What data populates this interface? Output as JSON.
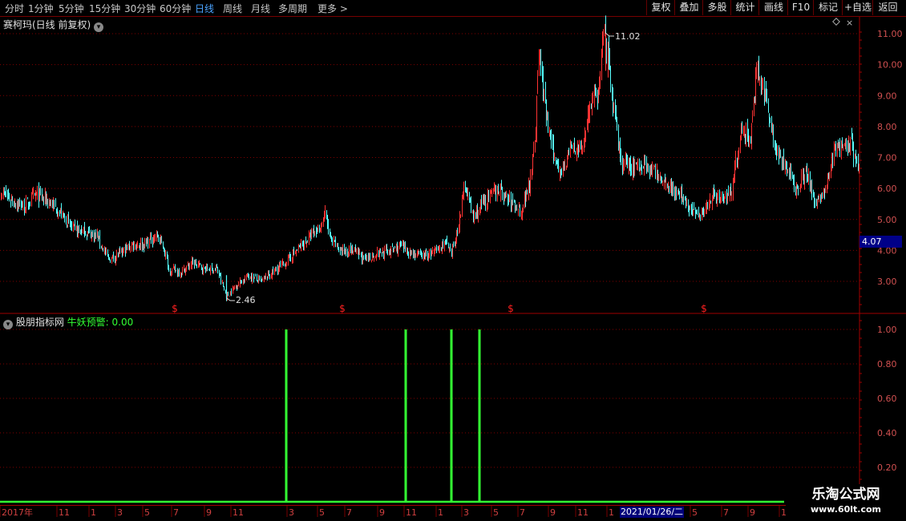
{
  "toolbar": {
    "tabs": [
      "分时",
      "1分钟",
      "5分钟",
      "15分钟",
      "30分钟",
      "60分钟",
      "日线",
      "周线",
      "月线",
      "多周期",
      "更多 >"
    ],
    "active_tab": "日线",
    "right_buttons": [
      "复权",
      "叠加",
      "多股",
      "统计",
      "画线",
      "F10",
      "标记",
      "+自选",
      "返回"
    ]
  },
  "main_panel": {
    "title": "赛柯玛(日线 前复权)",
    "price_labels": [
      "11.00",
      "10.00",
      "9.00",
      "8.00",
      "7.00",
      "6.00",
      "5.00",
      "4.00",
      "3.00"
    ],
    "current_price": "4.07",
    "max_label": "11.02",
    "min_label": "2.46",
    "marker_symbol": "$"
  },
  "indicator_panel": {
    "source_label": "股朋指标网",
    "indicator_label": "牛妖预警: 0.00",
    "y_labels": [
      "1.00",
      "0.80",
      "0.60",
      "0.40",
      "0.20"
    ]
  },
  "x_axis": {
    "labels": [
      "2017年",
      "11",
      "1",
      "3",
      "5",
      "7",
      "9",
      "11",
      "3",
      "5",
      "7",
      "9",
      "11",
      "1",
      "3",
      "5",
      "7",
      "9",
      "11",
      "1",
      "3",
      "5",
      "7",
      "9",
      "11"
    ],
    "cursor_date": "2021/01/26/二"
  },
  "watermark": {
    "line1": "乐淘公式网",
    "line2": "www.60lt.com"
  },
  "colors": {
    "up": "#ff3333",
    "down": "#54ffff",
    "signal": "#33ff33",
    "grid": "#800000",
    "axis": "#a00000"
  },
  "chart_data": [
    {
      "type": "candlestick",
      "title": "赛柯玛(日线 前复权)",
      "ylim": [
        2.2,
        11.3
      ],
      "y_ticks": [
        3,
        4,
        5,
        6,
        7,
        8,
        9,
        10,
        11
      ],
      "annotations": [
        {
          "label": "11.02",
          "value": 11.02
        },
        {
          "label": "2.46",
          "value": 2.46
        }
      ],
      "price_path": [
        [
          0,
          5.9
        ],
        [
          15,
          5.6
        ],
        [
          30,
          5.4
        ],
        [
          45,
          5.8
        ],
        [
          60,
          5.6
        ],
        [
          75,
          5.2
        ],
        [
          90,
          4.7
        ],
        [
          105,
          4.6
        ],
        [
          120,
          4.5
        ],
        [
          135,
          3.7
        ],
        [
          150,
          3.9
        ],
        [
          165,
          4.2
        ],
        [
          180,
          4.2
        ],
        [
          195,
          4.5
        ],
        [
          205,
          4.0
        ],
        [
          210,
          3.4
        ],
        [
          225,
          3.3
        ],
        [
          240,
          3.6
        ],
        [
          255,
          3.4
        ],
        [
          270,
          3.4
        ],
        [
          282,
          2.5
        ],
        [
          295,
          2.9
        ],
        [
          310,
          3.2
        ],
        [
          325,
          3.0
        ],
        [
          340,
          3.3
        ],
        [
          355,
          3.6
        ],
        [
          370,
          4.0
        ],
        [
          385,
          4.4
        ],
        [
          398,
          4.7
        ],
        [
          405,
          5.2
        ],
        [
          412,
          4.3
        ],
        [
          425,
          4.0
        ],
        [
          440,
          4.0
        ],
        [
          455,
          3.7
        ],
        [
          470,
          3.9
        ],
        [
          485,
          4.0
        ],
        [
          500,
          4.1
        ],
        [
          515,
          3.9
        ],
        [
          530,
          3.8
        ],
        [
          545,
          4.0
        ],
        [
          555,
          4.3
        ],
        [
          562,
          3.8
        ],
        [
          570,
          4.6
        ],
        [
          580,
          6.2
        ],
        [
          590,
          5.0
        ],
        [
          600,
          5.5
        ],
        [
          610,
          5.7
        ],
        [
          620,
          6.0
        ],
        [
          635,
          5.6
        ],
        [
          650,
          5.3
        ],
        [
          660,
          6.2
        ],
        [
          668,
          8.0
        ],
        [
          672,
          10.5
        ],
        [
          680,
          8.5
        ],
        [
          690,
          7.0
        ],
        [
          700,
          6.6
        ],
        [
          712,
          7.3
        ],
        [
          725,
          7.2
        ],
        [
          735,
          8.7
        ],
        [
          745,
          9.0
        ],
        [
          752,
          10.9
        ],
        [
          758,
          10.2
        ],
        [
          765,
          8.5
        ],
        [
          775,
          6.8
        ],
        [
          790,
          6.7
        ],
        [
          805,
          6.8
        ],
        [
          820,
          6.4
        ],
        [
          835,
          6.1
        ],
        [
          850,
          5.7
        ],
        [
          865,
          5.2
        ],
        [
          878,
          5.3
        ],
        [
          890,
          5.9
        ],
        [
          900,
          5.6
        ],
        [
          912,
          6.0
        ],
        [
          925,
          7.9
        ],
        [
          935,
          7.6
        ],
        [
          943,
          9.6
        ],
        [
          950,
          9.4
        ],
        [
          958,
          8.5
        ],
        [
          968,
          7.2
        ],
        [
          982,
          6.6
        ],
        [
          992,
          6.0
        ],
        [
          1005,
          6.6
        ],
        [
          1015,
          5.6
        ],
        [
          1028,
          5.8
        ],
        [
          1040,
          7.2
        ],
        [
          1050,
          7.5
        ],
        [
          1062,
          7.4
        ],
        [
          1070,
          6.6
        ]
      ],
      "markers": [
        {
          "x": 218,
          "label": "$"
        },
        {
          "x": 427,
          "label": "$"
        },
        {
          "x": 637,
          "label": "$"
        },
        {
          "x": 878,
          "label": "$"
        }
      ]
    },
    {
      "type": "bar",
      "series": [
        {
          "name": "牛妖预警",
          "signals": [
            {
              "x": 357,
              "value": 1.0
            },
            {
              "x": 506,
              "value": 1.0
            },
            {
              "x": 563,
              "value": 1.0
            },
            {
              "x": 598,
              "value": 1.0
            }
          ]
        }
      ],
      "ylim": [
        0,
        1.05
      ],
      "y_ticks": [
        0.2,
        0.4,
        0.6,
        0.8,
        1.0
      ]
    }
  ]
}
